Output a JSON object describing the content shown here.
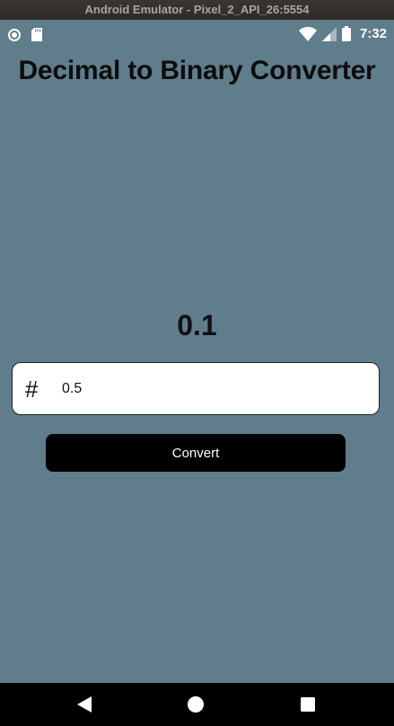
{
  "window": {
    "title": "Android Emulator - Pixel_2_API_26:5554"
  },
  "status_bar": {
    "time": "7:32",
    "left_icons": [
      "notification-circle-icon",
      "sd-card-icon"
    ],
    "right_icons": [
      "wifi-icon",
      "cell-signal-icon",
      "battery-icon"
    ]
  },
  "app": {
    "title": "Decimal to Binary Converter",
    "result": "0.1",
    "input": {
      "icon": "hash-icon",
      "value": "0.5"
    },
    "convert_label": "Convert"
  },
  "nav_bar": {
    "buttons": [
      "back-icon",
      "home-icon",
      "recents-icon"
    ]
  },
  "colors": {
    "background": "#607D8B",
    "button": "#000000",
    "button_text": "#FFFFFF",
    "input_bg": "#FFFFFF",
    "nav_bar": "#000000"
  }
}
